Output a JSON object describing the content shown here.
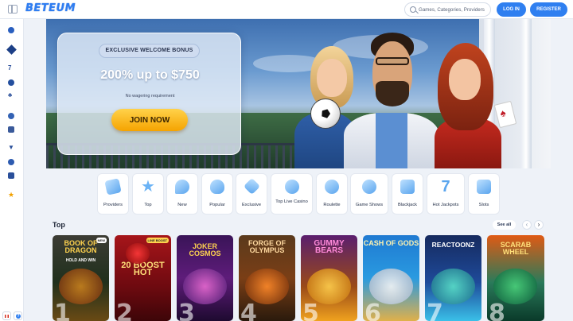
{
  "header": {
    "logo": "BETEUM",
    "search_placeholder": "Games, Categories, Providers",
    "login_label": "LOG IN",
    "register_label": "REGISTER"
  },
  "sidebar": {
    "icons": [
      "casino-icon",
      "sports-icon",
      "seven-icon",
      "poker-chip-icon",
      "spade-icon",
      "chat-icon",
      "live-icon",
      "trophy-icon",
      "promo-icon",
      "gift-icon",
      "star-icon"
    ]
  },
  "hero": {
    "tag": "EXCLUSIVE WELCOME BONUS",
    "amount": "200% up to $750",
    "subtext": "No wagering requirement",
    "cta": "JOIN NOW"
  },
  "categories": [
    {
      "label": "Providers",
      "icon": "cards-icon"
    },
    {
      "label": "Top",
      "icon": "star-icon"
    },
    {
      "label": "New",
      "icon": "new-icon"
    },
    {
      "label": "Popular",
      "icon": "flame-icon"
    },
    {
      "label": "Exclusive",
      "icon": "diamond-icon"
    },
    {
      "label": "Top Live Casino",
      "icon": "live-casino-icon"
    },
    {
      "label": "Roulette",
      "icon": "roulette-icon"
    },
    {
      "label": "Game Shows",
      "icon": "game-show-icon"
    },
    {
      "label": "Blackjack",
      "icon": "blackjack-icon"
    },
    {
      "label": "Hot Jackpots",
      "icon": "jackpot-icon"
    },
    {
      "label": "Slots",
      "icon": "slots-icon"
    }
  ],
  "top_section": {
    "title": "Top",
    "see_all": "See all",
    "prev_arrow": "‹",
    "next_arrow": "›"
  },
  "games": [
    {
      "title": "BOOK OF DRAGON",
      "subtitle": "HOLD AND WIN",
      "rank": "1",
      "badge": "NEW"
    },
    {
      "title": "20 BOOST HOT",
      "subtitle": "LINE BOOST",
      "rank": "2",
      "badge": ""
    },
    {
      "title": "JOKER COSMOS",
      "subtitle": "",
      "rank": "3",
      "badge": ""
    },
    {
      "title": "FORGE OF OLYMPUS",
      "subtitle": "",
      "rank": "4",
      "badge": ""
    },
    {
      "title": "GUMMY BEARS",
      "subtitle": "",
      "rank": "5",
      "badge": ""
    },
    {
      "title": "CASH OF GODS",
      "subtitle": "",
      "rank": "6",
      "badge": ""
    },
    {
      "title": "REACTOONZ",
      "subtitle": "",
      "rank": "7",
      "badge": ""
    },
    {
      "title": "SCARAB WHEEL",
      "subtitle": "",
      "rank": "8",
      "badge": ""
    }
  ]
}
